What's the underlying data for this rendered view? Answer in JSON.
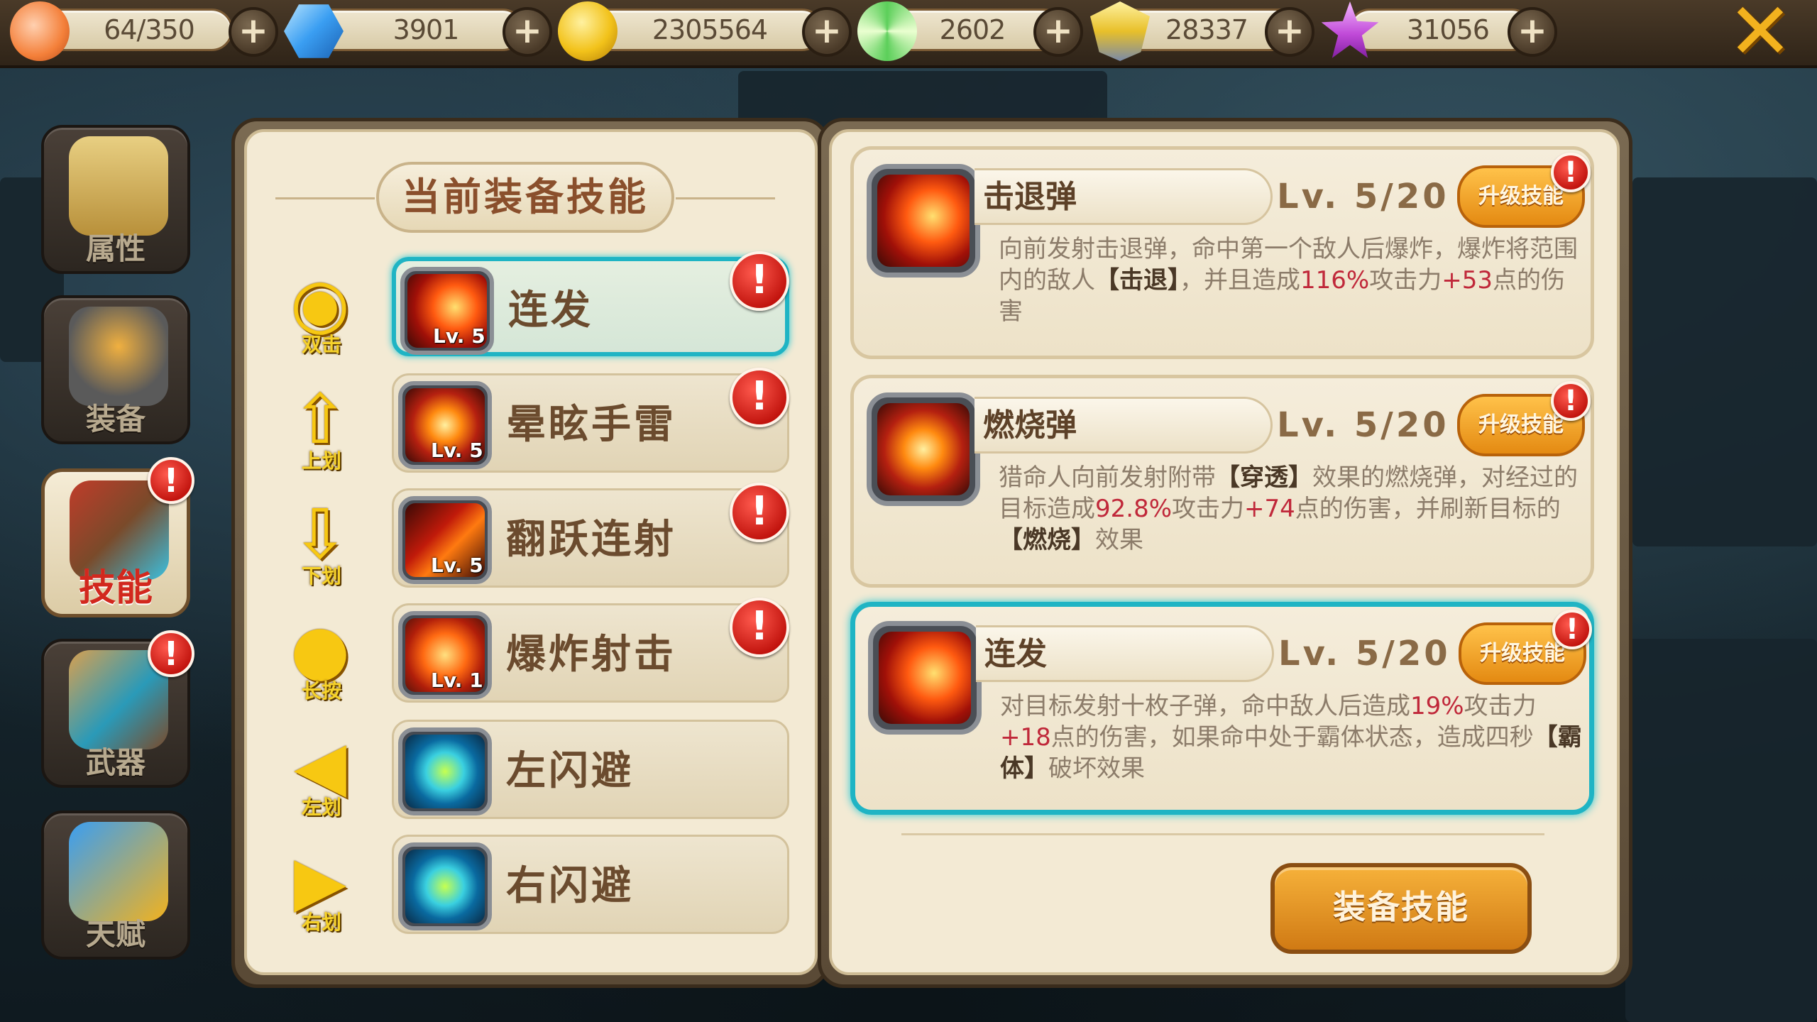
{
  "resources": [
    {
      "icon": "peach-icon",
      "value": "64/350",
      "color": "#f4a35a"
    },
    {
      "icon": "diamond-icon",
      "value": "3901",
      "color": "#3a9ef2"
    },
    {
      "icon": "gold-coin-icon",
      "value": "2305564",
      "color": "#f2c21a"
    },
    {
      "icon": "lollipop-icon",
      "value": "2602",
      "color": "#5ccf5a"
    },
    {
      "icon": "trophy-shield-icon",
      "value": "28337",
      "color": "#e8c02a"
    },
    {
      "icon": "star-badge-icon",
      "value": "31056",
      "color": "#c04ad8"
    }
  ],
  "sidebar": {
    "items": [
      {
        "label": "属性",
        "icon": "scroll-icon"
      },
      {
        "label": "装备",
        "icon": "helmet-icon"
      },
      {
        "label": "技能",
        "icon": "skill-book-icon",
        "active": true
      },
      {
        "label": "武器",
        "icon": "crossbow-icon"
      },
      {
        "label": "天赋",
        "icon": "talent-chart-icon"
      }
    ],
    "alert_mark": "!"
  },
  "equipped": {
    "title": "当前装备技能",
    "rows": [
      {
        "gesture": "双击",
        "gesture_icon": "double-tap-icon",
        "name": "连发",
        "lv": "Lv. 5",
        "alert": true,
        "selected": true,
        "art": "fire-burst"
      },
      {
        "gesture": "上划",
        "gesture_icon": "swipe-up-icon",
        "name": "晕眩手雷",
        "lv": "Lv. 5",
        "alert": true,
        "selected": false,
        "art": "fire-grenade"
      },
      {
        "gesture": "下划",
        "gesture_icon": "swipe-down-icon",
        "name": "翻跃连射",
        "lv": "Lv. 5",
        "alert": true,
        "selected": false,
        "art": "fire-rain"
      },
      {
        "gesture": "长按",
        "gesture_icon": "long-press-icon",
        "name": "爆炸射击",
        "lv": "Lv. 1",
        "alert": true,
        "selected": false,
        "art": "explosion"
      },
      {
        "gesture": "左划",
        "gesture_icon": "swipe-left-icon",
        "name": "左闪避",
        "lv": "",
        "alert": false,
        "selected": false,
        "art": "dodge"
      },
      {
        "gesture": "右划",
        "gesture_icon": "swipe-right-icon",
        "name": "右闪避",
        "lv": "",
        "alert": false,
        "selected": false,
        "art": "dodge"
      }
    ]
  },
  "skills": [
    {
      "name": "击退弹",
      "level": "Lv.  5/20",
      "upgrade_label": "升级技能",
      "selected": false,
      "desc": [
        {
          "t": "向前发射击退弹，命中第一个敌人后爆炸，爆炸将范围内的敌人"
        },
        {
          "t": "【击退】",
          "s": "bk"
        },
        {
          "t": "，并且造成"
        },
        {
          "t": "116%",
          "s": "hl"
        },
        {
          "t": "攻击力"
        },
        {
          "t": "+53",
          "s": "hl"
        },
        {
          "t": "点的伤害"
        }
      ]
    },
    {
      "name": "燃烧弹",
      "level": "Lv.  5/20",
      "upgrade_label": "升级技能",
      "selected": false,
      "desc": [
        {
          "t": "猎命人向前发射附带"
        },
        {
          "t": "【穿透】",
          "s": "bk"
        },
        {
          "t": "效果的燃烧弹，对经过的目标造成"
        },
        {
          "t": "92.8%",
          "s": "hl"
        },
        {
          "t": "攻击力"
        },
        {
          "t": "+74",
          "s": "hl"
        },
        {
          "t": "点的伤害，并刷新目标的"
        },
        {
          "t": "【燃烧】",
          "s": "bk"
        },
        {
          "t": "效果"
        }
      ]
    },
    {
      "name": "连发",
      "level": "Lv.  5/20",
      "upgrade_label": "升级技能",
      "selected": true,
      "desc": [
        {
          "t": "对目标发射十枚子弹，命中敌人后造成"
        },
        {
          "t": "19%",
          "s": "hl"
        },
        {
          "t": "攻击力"
        },
        {
          "t": "+18",
          "s": "hl"
        },
        {
          "t": "点的伤害，如果命中处于霸体状态，造成四秒"
        },
        {
          "t": "【霸体】",
          "s": "bk"
        },
        {
          "t": "破坏效果"
        }
      ]
    }
  ],
  "equip_button_label": "装备技能",
  "close_glyph": "✕",
  "plus_glyph": "+",
  "colors": {
    "accent_cyan": "#1fb4c4",
    "alert_red": "#d8201a",
    "button_orange": "#e48a12"
  }
}
